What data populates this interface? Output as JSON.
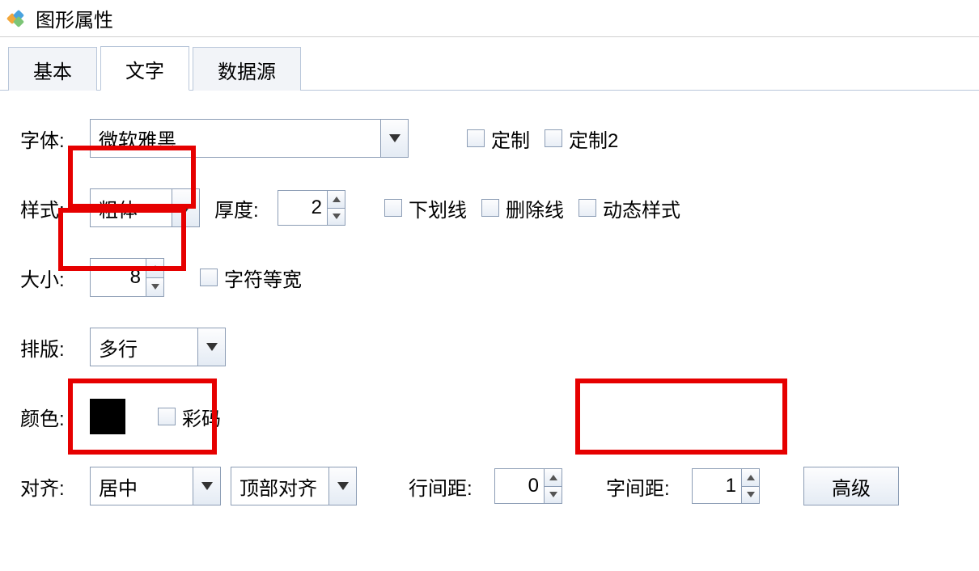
{
  "window": {
    "title": "图形属性"
  },
  "tabs": {
    "items": [
      "基本",
      "文字",
      "数据源"
    ],
    "activeIndex": 1
  },
  "labels": {
    "font": "字体:",
    "style": "样式:",
    "thickness": "厚度:",
    "size": "大小:",
    "layout": "排版:",
    "color": "颜色:",
    "align": "对齐:",
    "lineSpacing": "行间距:",
    "charSpacing": "字间距:"
  },
  "values": {
    "font": "微软雅黑",
    "style": "粗体",
    "thickness": "2",
    "size": "8",
    "layout": "多行",
    "alignH": "居中",
    "alignV": "顶部对齐",
    "lineSpacing": "0",
    "charSpacing": "1"
  },
  "checkboxes": {
    "custom1": "定制",
    "custom2": "定制2",
    "underline": "下划线",
    "strikethrough": "删除线",
    "dynamicStyle": "动态样式",
    "monospace": "字符等宽",
    "colorCode": "彩码"
  },
  "buttons": {
    "advanced": "高级"
  },
  "color": {
    "hex": "#000000"
  }
}
